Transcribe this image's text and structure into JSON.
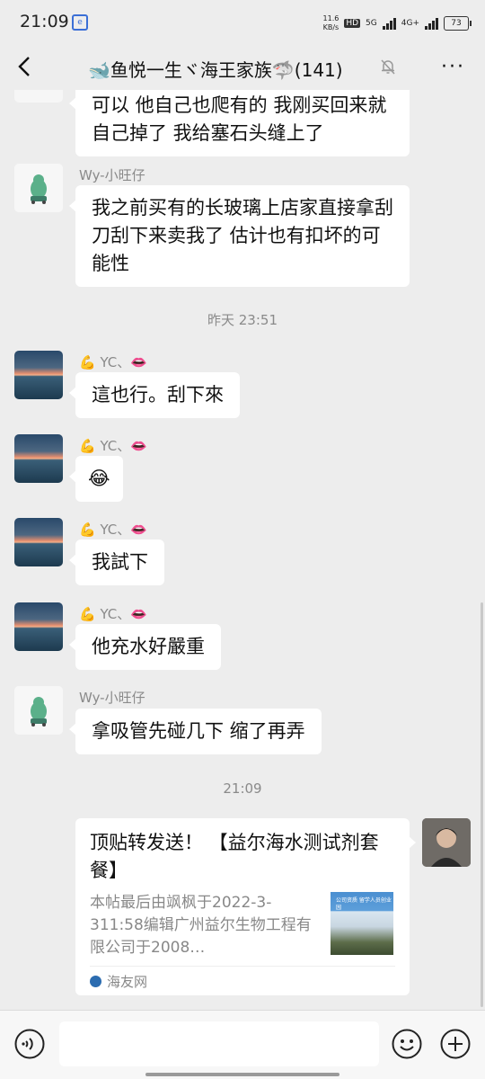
{
  "status_bar": {
    "time": "21:09",
    "net_speed_value": "11.6",
    "net_speed_unit": "KB/s",
    "hd_label": "HD",
    "network_5g": "5G",
    "network_4g": "4G+",
    "battery": "73"
  },
  "header": {
    "title": "🐋鱼悦一生ヾ海王家族🦈(141)",
    "more_label": "···"
  },
  "messages": [
    {
      "id": "m0",
      "text": "可以 他自己也爬有的 我刚买回来就自己掉了 我给塞石头缝上了"
    },
    {
      "id": "m1",
      "sender": "Wy-小旺仔",
      "text": "我之前买有的长玻璃上店家直接拿刮刀刮下来卖我了 估计也有扣坏的可能性"
    },
    {
      "id": "t1",
      "time": "昨天 23:51"
    },
    {
      "id": "m2",
      "sender": "💪 YC、👄",
      "text": "這也行。刮下來"
    },
    {
      "id": "m3",
      "sender": "💪 YC、👄",
      "text": "😂"
    },
    {
      "id": "m4",
      "sender": "💪 YC、👄",
      "text": "我試下"
    },
    {
      "id": "m5",
      "sender": "💪 YC、👄",
      "text": "他充水好嚴重"
    },
    {
      "id": "m6",
      "sender": "Wy-小旺仔",
      "text": "拿吸管先碰几下 缩了再弄"
    },
    {
      "id": "t2",
      "time": "21:09"
    }
  ],
  "link_card": {
    "title": "顶贴转发送！ 【益尔海水测试剂套餐】",
    "description": "本帖最后由飒枫于2022-3-311:58编辑广州益尔生物工程有限公司于2008…",
    "thumb_text": "公司资质 留学人员创业园",
    "source": "海友网"
  },
  "input_bar": {
    "placeholder": ""
  }
}
